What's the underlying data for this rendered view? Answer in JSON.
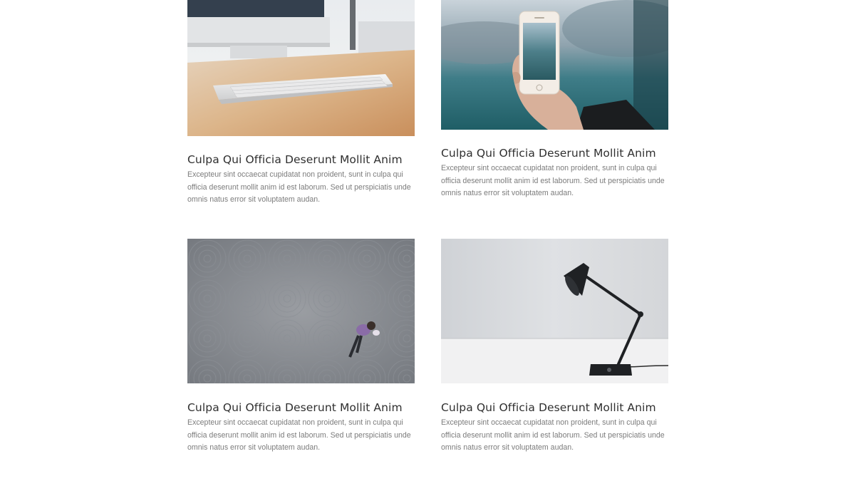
{
  "cards": [
    {
      "image": "keyboard-on-desk-photo",
      "title": "Culpa Qui Officia Deserunt Mollit Anim",
      "text": "Excepteur sint occaecat cupidatat non proident, sunt in culpa qui officia deserunt mollit anim id est laborum. Sed ut perspiciatis unde omnis natus error sit voluptatem audan."
    },
    {
      "image": "hand-holding-phone-lake-photo",
      "title": "Culpa Qui Officia Deserunt Mollit Anim",
      "text": "Excepteur sint occaecat cupidatat non proident, sunt in culpa qui officia deserunt mollit anim id est laborum. Sed ut perspiciatis unde omnis natus error sit voluptatem audan."
    },
    {
      "image": "person-on-patterned-floor-photo",
      "title": "Culpa Qui Officia Deserunt Mollit Anim",
      "text": "Excepteur sint occaecat cupidatat non proident, sunt in culpa qui officia deserunt mollit anim id est laborum. Sed ut perspiciatis unde omnis natus error sit voluptatem audan."
    },
    {
      "image": "desk-lamp-photo",
      "title": "Culpa Qui Officia Deserunt Mollit Anim",
      "text": "Excepteur sint occaecat cupidatat non proident, sunt in culpa qui officia deserunt mollit anim id est laborum. Sed ut perspiciatis unde omnis natus error sit voluptatem audan."
    }
  ],
  "colors": {
    "title": "#2f2f2f",
    "body_text": "#7c7c7c",
    "background": "#ffffff"
  }
}
